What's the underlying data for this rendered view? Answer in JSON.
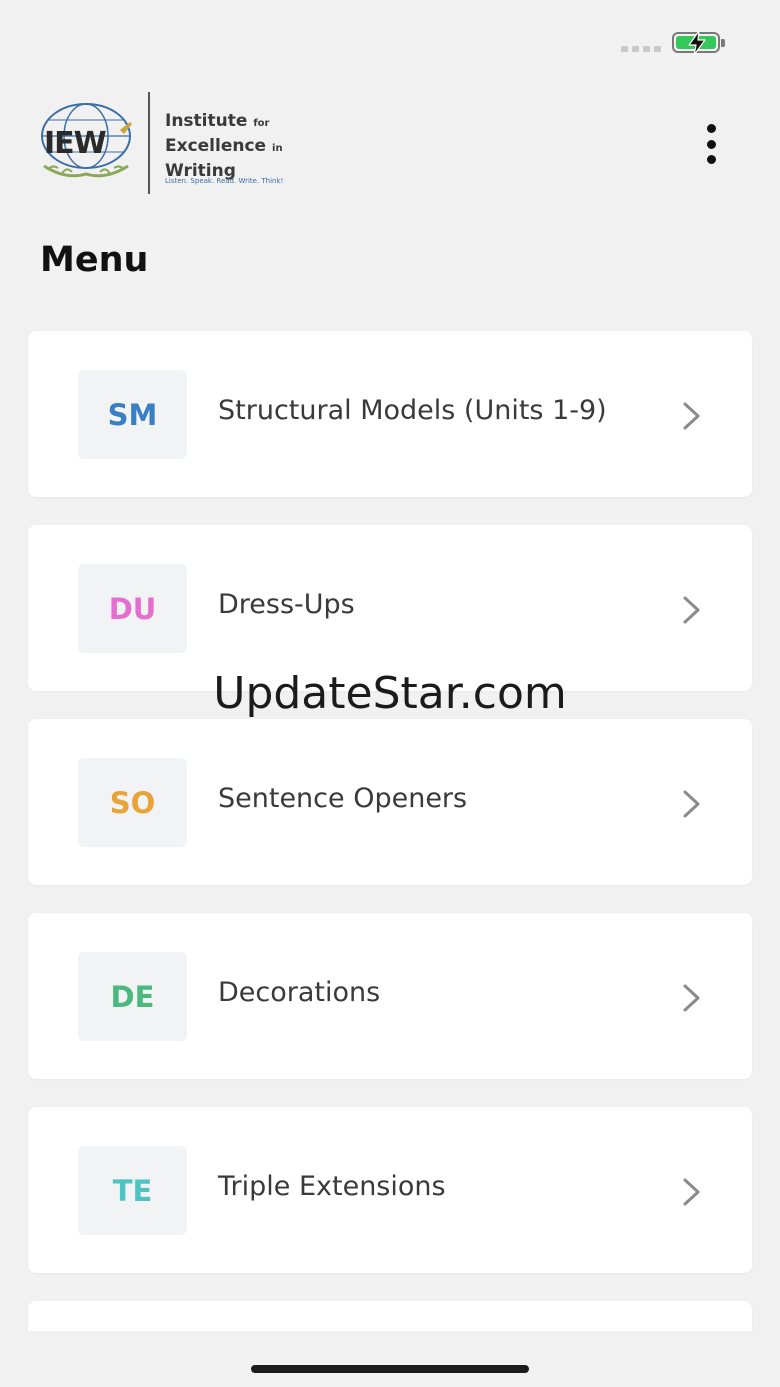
{
  "status_bar": {
    "battery_level": 1.0,
    "charging": true,
    "battery_color": "#34c759"
  },
  "header": {
    "logo": {
      "mark_text": "IEW",
      "line1_main": "Institute",
      "line1_small": "for",
      "line2_main": "Excellence",
      "line2_small": "in",
      "line3_main": "Writing",
      "tagline": "Listen. Speak. Read. Write. Think!"
    },
    "more_icon": "more-vertical-icon"
  },
  "page": {
    "title": "Menu"
  },
  "menu": {
    "items": [
      {
        "abbr": "SM",
        "label": "Structural Models (Units 1-9)",
        "color": "#3a7fc1"
      },
      {
        "abbr": "DU",
        "label": "Dress-Ups",
        "color": "#e56fcf"
      },
      {
        "abbr": "SO",
        "label": "Sentence Openers",
        "color": "#e8a33a"
      },
      {
        "abbr": "DE",
        "label": "Decorations",
        "color": "#4cb87e"
      },
      {
        "abbr": "TE",
        "label": "Triple Extensions",
        "color": "#4fc2c4"
      }
    ],
    "chevron_icon": "chevron-right-icon"
  },
  "watermark": {
    "text": "UpdateStar.com"
  }
}
